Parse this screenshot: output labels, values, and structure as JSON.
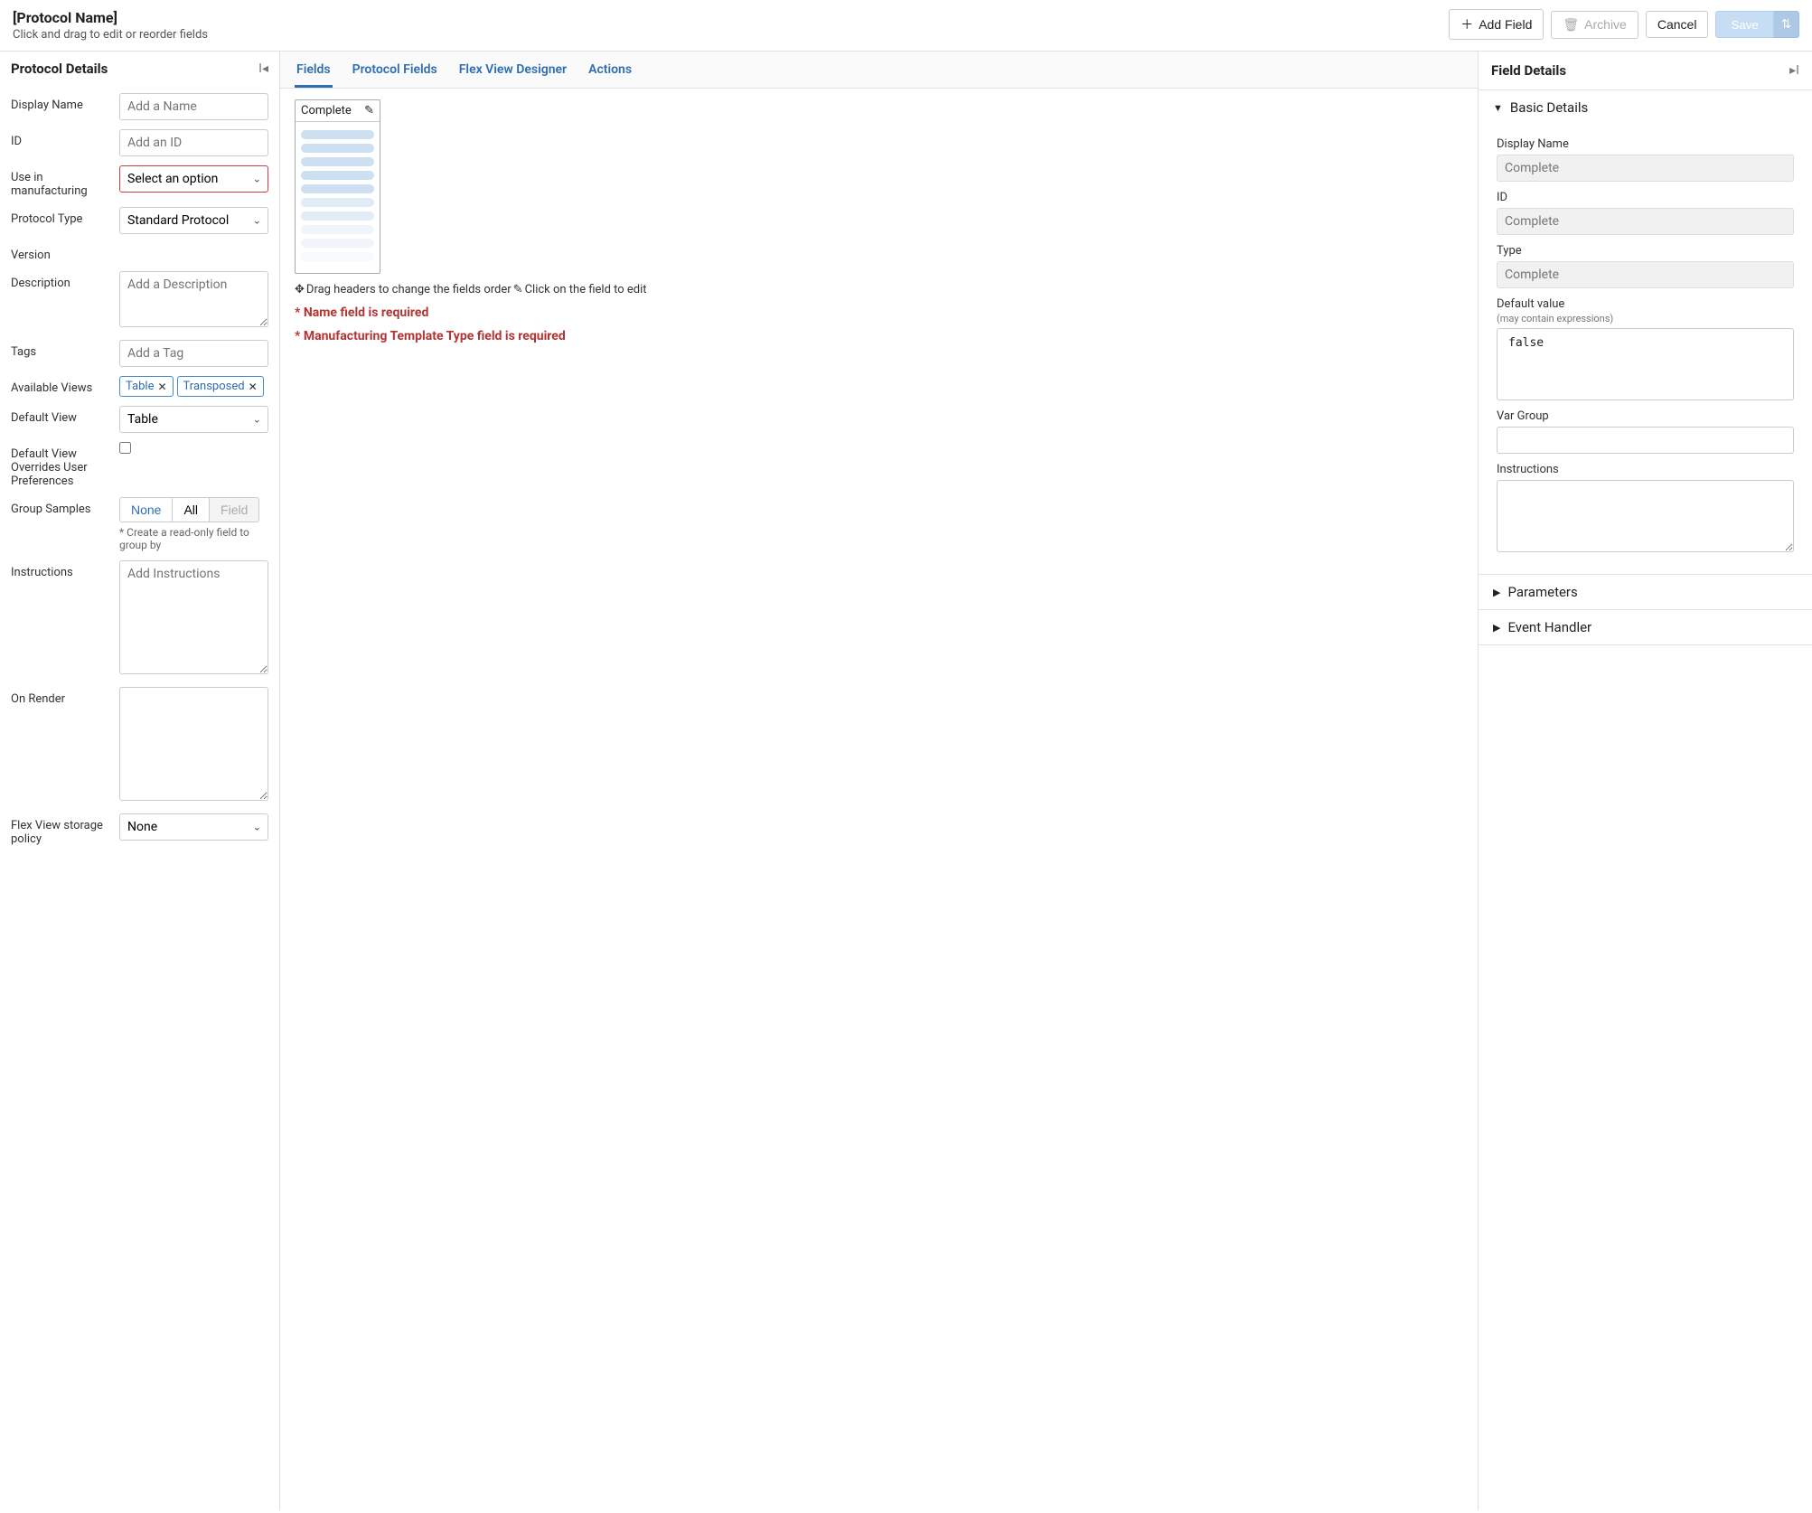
{
  "header": {
    "title": "[Protocol Name]",
    "subtitle": "Click and drag to edit or reorder fields",
    "add_field": "Add Field",
    "archive": "Archive",
    "cancel": "Cancel",
    "save": "Save"
  },
  "left_panel": {
    "title": "Protocol Details",
    "labels": {
      "display_name": "Display Name",
      "id": "ID",
      "use_in_manufacturing": "Use in manufacturing",
      "protocol_type": "Protocol Type",
      "version": "Version",
      "description": "Description",
      "tags": "Tags",
      "available_views": "Available Views",
      "default_view": "Default View",
      "default_view_overrides": "Default View Overrides User Preferences",
      "group_samples": "Group Samples",
      "instructions": "Instructions",
      "on_render": "On Render",
      "flex_view_storage": "Flex View storage policy"
    },
    "placeholders": {
      "display_name": "Add a Name",
      "id": "Add an ID",
      "description": "Add a Description",
      "tags": "Add a Tag",
      "instructions": "Add Instructions"
    },
    "use_in_manufacturing_value": "Select an option",
    "protocol_type_value": "Standard Protocol",
    "available_views_chips": [
      "Table",
      "Transposed"
    ],
    "default_view_value": "Table",
    "group_samples_options": {
      "none": "None",
      "all": "All",
      "field": "Field"
    },
    "group_samples_note": "* Create a read-only field to group by",
    "flex_view_storage_value": "None"
  },
  "center_panel": {
    "tabs": [
      "Fields",
      "Protocol Fields",
      "Flex View Designer",
      "Actions"
    ],
    "field_card_title": "Complete",
    "hint_drag": "Drag headers to change the fields order",
    "hint_click": "Click on the field to edit",
    "errors": [
      "* Name field is required",
      "* Manufacturing Template Type field is required"
    ]
  },
  "right_panel": {
    "title": "Field Details",
    "sections": {
      "basic": "Basic Details",
      "parameters": "Parameters",
      "event_handler": "Event Handler"
    },
    "labels": {
      "display_name": "Display Name",
      "id": "ID",
      "type": "Type",
      "default_value": "Default value",
      "default_value_sub": "(may contain expressions)",
      "var_group": "Var Group",
      "instructions": "Instructions"
    },
    "values": {
      "display_name": "Complete",
      "id": "Complete",
      "type": "Complete",
      "default_value": "false"
    }
  }
}
